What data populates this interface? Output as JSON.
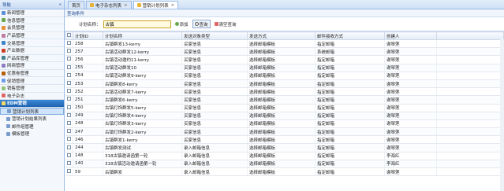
{
  "sidebar": {
    "title": "导航",
    "collapse": "«",
    "items": [
      {
        "label": "新闻管理",
        "color": "#5b8fd6"
      },
      {
        "label": "信息管理",
        "color": "#6aa84f"
      },
      {
        "label": "会员管理",
        "color": "#e69138"
      },
      {
        "label": "产品管理",
        "color": "#c27ba0"
      },
      {
        "label": "交易管理",
        "color": "#3d85c6"
      },
      {
        "label": "产业数据",
        "color": "#cc4125"
      },
      {
        "label": "产品库管理",
        "color": "#45818e"
      },
      {
        "label": "网商管理",
        "color": "#8e7cc3"
      },
      {
        "label": "优惠卷管理",
        "color": "#b45f06"
      },
      {
        "label": "促销管理",
        "color": "#6d9eeb"
      },
      {
        "label": "销售管理",
        "color": "#93c47d"
      },
      {
        "label": "电子杂志",
        "color": "#e06666"
      }
    ],
    "active_group": "EDM营销",
    "subitems": [
      "营销计划列表",
      "营销计划结果列表",
      "邮件组管理",
      "模板管理"
    ],
    "active_sub": 0
  },
  "tabs": [
    {
      "label": "首页",
      "close": ""
    },
    {
      "label": "电子杂志列表",
      "close": "×"
    },
    {
      "label": "营销计划列表",
      "close": "×"
    }
  ],
  "active_tab": 2,
  "search": {
    "section": "查询条件",
    "label": "计划名称：",
    "value": "古镇",
    "add": "添加",
    "query": "查询",
    "clear": "清空查询"
  },
  "table": {
    "headers": [
      "计划ID",
      "计划名称",
      "发送对象类型",
      "发送方式",
      "邮件接收方式",
      "创建人"
    ],
    "rows": [
      [
        "258",
        "古镇群发13-kerry",
        "买家信息",
        "选择邮箱模板",
        "指定邮箱",
        "谢琴莲"
      ],
      [
        "257",
        "古镇活动群发12-kerry",
        "买家信息",
        "选择邮箱模板",
        "系统邮箱",
        "谢琴莲"
      ],
      [
        "256",
        "古镇活动邀约11-kerry",
        "买家信息",
        "选择邮箱模板",
        "指定邮箱",
        "谢琴莲"
      ],
      [
        "255",
        "古镇活动群发10",
        "买家信息",
        "选择邮箱模板",
        "指定邮箱",
        "谢琴莲"
      ],
      [
        "254",
        "古镇活动群发9-kerry",
        "买家信息",
        "选择邮箱模板",
        "指定邮箱",
        "谢琴莲"
      ],
      [
        "253",
        "古镇群发8-kerry",
        "买家信息",
        "选择邮箱模板",
        "指定邮箱",
        "谢琴莲"
      ],
      [
        "252",
        "古镇活动群发7-kerry",
        "买家信息",
        "选择邮箱模板",
        "指定邮箱",
        "谢琴莲"
      ],
      [
        "251",
        "古镇群发6-kerry",
        "买家信息",
        "选择邮箱模板",
        "指定邮箱",
        "谢琴莲"
      ],
      [
        "250",
        "古镇灯饰群发5-kerry",
        "买家信息",
        "选择邮箱模板",
        "指定邮箱",
        "谢琴莲"
      ],
      [
        "249",
        "古镇灯饰群发4-kerry",
        "买家信息",
        "选择邮箱模板",
        "指定邮箱",
        "谢琴莲"
      ],
      [
        "248",
        "古镇灯饰群发3-kerry",
        "买家信息",
        "选择邮箱模板",
        "指定邮箱",
        "谢琴莲"
      ],
      [
        "247",
        "古镇灯饰群发2-kerry",
        "买家信息",
        "选择邮箱模板",
        "指定邮箱",
        "谢琴莲"
      ],
      [
        "246",
        "古镇群发1-kerry",
        "买家信息",
        "选择邮箱模板",
        "指定邮箱",
        "谢琴莲"
      ],
      [
        "244",
        "古镇群发测试",
        "录入邮箱信息",
        "选择邮箱模板",
        "指定邮箱",
        "谢琴莲"
      ],
      [
        "148",
        "318古镇邀请函第一轮",
        "录入邮箱信息",
        "选择邮箱模板",
        "指定邮箱",
        "李海红"
      ],
      [
        "140",
        "318古镇活动邀请函第一轮",
        "录入邮箱信息",
        "选择邮箱模板",
        "指定邮箱",
        "李海红"
      ],
      [
        "59",
        "古镇群发",
        "录入邮箱信息",
        "选择邮箱模板",
        "指定邮箱",
        "谢琴莲"
      ]
    ]
  }
}
